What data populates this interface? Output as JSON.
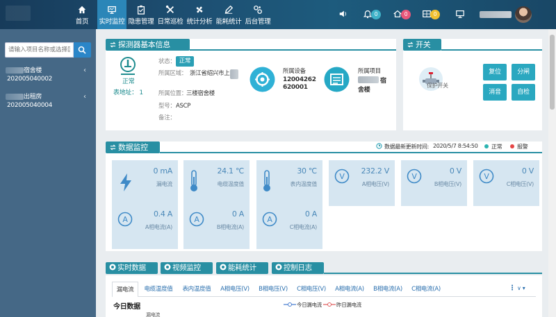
{
  "nav": [
    {
      "label": "首页",
      "icon": "home-icon"
    },
    {
      "label": "实时监控",
      "icon": "monitor-icon",
      "active": true
    },
    {
      "label": "隐患管理",
      "icon": "clipboard-icon"
    },
    {
      "label": "日常巡检",
      "icon": "tools-icon"
    },
    {
      "label": "统计分析",
      "icon": "fan-icon"
    },
    {
      "label": "能耗统计",
      "icon": "pen-icon"
    },
    {
      "label": "后台管理",
      "icon": "settings-icon"
    }
  ],
  "header": {
    "badges": {
      "alerts": "0",
      "home": "0",
      "grid": "0"
    },
    "badge_colors": {
      "alerts": "#3fb2c8",
      "home": "#e8577a",
      "grid": "#f0c030"
    }
  },
  "sidebar": {
    "search_placeholder": "请输入项目名称或选择区",
    "items": [
      {
        "name": "宿舍楼",
        "code": "202005040002"
      },
      {
        "name": "出租房",
        "code": "202005040004"
      }
    ]
  },
  "detector": {
    "section_title": "探测器基本信息",
    "status_text": "正常",
    "addr_text": "表地址：",
    "addr_value": "1",
    "state_label": "状态：",
    "state_value": "正常",
    "area_label": "所属区域：",
    "area_value": "浙江省绍兴市上",
    "loc_label": "所属位置：",
    "loc_value": "三楼宿舍楼",
    "model_label": "型号：",
    "model_value": "ASCP",
    "note_label": "备注：",
    "note_value": "",
    "device_label": "所属设备",
    "device_line1": "12004262",
    "device_line2": "620001",
    "project_label": "所属项目",
    "project_line1": "宿",
    "project_line2": "舍楼"
  },
  "switch": {
    "section_title": "开关",
    "protect_label": "保护开关",
    "buttons": [
      "复位",
      "分闸",
      "消音",
      "自检"
    ]
  },
  "monitor": {
    "section_title": "数据监控",
    "update_label": "数据最新更新时间:",
    "update_time": "2020/5/7 8:54:50",
    "legend_normal": "正常",
    "legend_alarm": "报警",
    "tiles": [
      {
        "value": "0 mA",
        "label": "漏电流",
        "icon": "bolt-icon"
      },
      {
        "value": "24.1 ℃",
        "label": "电缆温度值",
        "icon": "thermometer-icon"
      },
      {
        "value": "30 ℃",
        "label": "表内温度值",
        "icon": "thermometer-icon"
      },
      {
        "value": "232.2 V",
        "label": "A相电压(V)",
        "icon": "volt-icon"
      },
      {
        "value": "0 V",
        "label": "B相电压(V)",
        "icon": "volt-icon"
      },
      {
        "value": "0 V",
        "label": "C相电压(V)",
        "icon": "volt-icon"
      },
      {
        "value": "0.4 A",
        "label": "A相电流(A)",
        "icon": "amp-icon"
      },
      {
        "value": "0 A",
        "label": "B相电流(A)",
        "icon": "amp-icon"
      },
      {
        "value": "0 A",
        "label": "C相电流(A)",
        "icon": "amp-icon"
      }
    ]
  },
  "bottom": {
    "subtabs": [
      "实时数据",
      "视频监控",
      "能耗统计",
      "控制日志"
    ],
    "tabs": [
      "漏电流",
      "电缆温度值",
      "表内温度值",
      "A相电压(V)",
      "B相电压(V)",
      "C相电压(V)",
      "A相电流(A)",
      "B相电流(A)",
      "C相电流(A)"
    ],
    "today_title": "今日数据",
    "legend_today": "今日漏电流",
    "legend_yesterday": "昨日漏电流",
    "axis_label": "漏电流"
  },
  "colors": {
    "accent": "#288fa3",
    "active_nav": "#2b86b8",
    "sidebar": "#456886",
    "tile": "#d6e6f1"
  }
}
